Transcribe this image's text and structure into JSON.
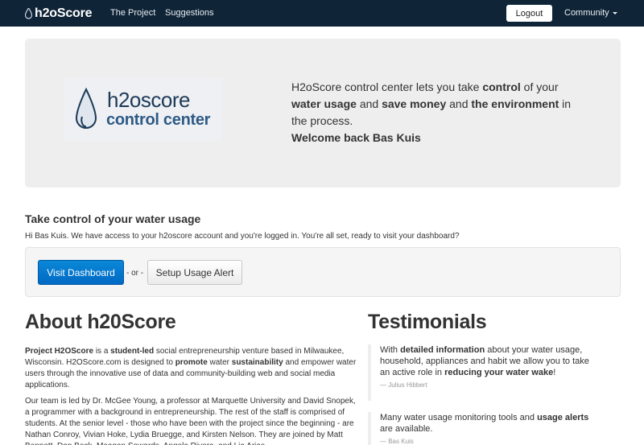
{
  "navbar": {
    "brand": "h2oScore",
    "links": [
      "The Project",
      "Suggestions"
    ],
    "logout_label": "Logout",
    "community_label": "Community"
  },
  "hero": {
    "logo_line1": "h2oscore",
    "logo_line2": "control center",
    "intro": [
      "H2oScore control center lets you take ",
      "control",
      " of your ",
      "water usage",
      " and ",
      "save money",
      " and ",
      "the environment",
      " in the process."
    ],
    "welcome": "Welcome back Bas Kuis"
  },
  "take_control": {
    "heading": "Take control of your water usage",
    "text": "Hi Bas Kuis. We have access to your h2oscore account and you're logged in. You're all set, ready to visit your dashboard?",
    "dashboard_button": "Visit Dashboard",
    "or_text": "- or -",
    "alert_button": "Setup Usage Alert"
  },
  "about": {
    "heading": "About h20Score",
    "p1": [
      "Project H2OScore",
      " is a ",
      "student-led",
      " social entrepreneurship venture based in Milwaukee, Wisconsin. H2OScore.com is designed to ",
      "promote",
      " water ",
      "sustainability",
      " and empower water users through the innovative use of data and community-building web and social media applications."
    ],
    "p2": "Our team is led by Dr. McGee Young, a professor at Marquette University and David Snopek, a programmer with a background in entrepreneurship. The rest of the staff is comprised of students. At the senior level - those who have been with the project since the beginning - are Nathan Conroy, Vivian Hoke, Lydia Bruegge, and Kirsten Nelson. They are joined by Matt Bennett, Dan Beck, Meagan Sowards, Angela Rivera, and Lia Arias."
  },
  "testimonials": {
    "heading": "Testimonials",
    "items": [
      {
        "parts": [
          "With ",
          "detailed information",
          " about your water usage, household, appliances and habit we allow you to take an active role in ",
          "reducing your water wake",
          "!"
        ],
        "cite": "— Julius Hibbert"
      },
      {
        "parts": [
          "Many water usage monitoring tools and ",
          "usage alerts",
          " are available."
        ],
        "cite": "— Bas Kuis"
      }
    ]
  },
  "colors": {
    "navbar_bg": "#0f2437",
    "primary_button": "#0a7fd3",
    "hero_bg": "#eeeeee"
  }
}
